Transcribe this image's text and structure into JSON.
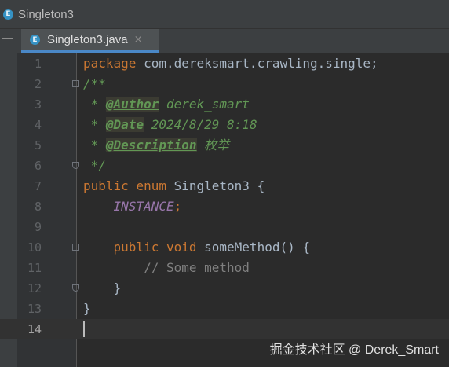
{
  "window": {
    "title": "Singleton3",
    "icon": "enum-class-icon",
    "icon_letter": "E"
  },
  "tab": {
    "label": "Singleton3.java",
    "close": "×",
    "icon_letter": "E",
    "accent": "#4a88c7"
  },
  "editor": {
    "line_numbers": [
      "1",
      "2",
      "3",
      "4",
      "5",
      "6",
      "7",
      "8",
      "9",
      "10",
      "11",
      "12",
      "13",
      "14"
    ],
    "current_line": 14,
    "lines": [
      {
        "kw1": "package",
        "text": " com.dereksmart.crawling.single;"
      },
      {
        "text": "/**"
      },
      {
        "star": " * ",
        "tag": "@Author",
        "rest": " derek_smart"
      },
      {
        "star": " * ",
        "tag": "@Date",
        "rest": " 2024/8/29 8:18"
      },
      {
        "star": " * ",
        "tag": "@Description",
        "rest": " 枚举"
      },
      {
        "text": " */"
      },
      {
        "kw1": "public",
        "kw2": "enum",
        "text": " Singleton3 {"
      },
      {
        "indent": "    ",
        "constant": "INSTANCE",
        "text": ";"
      },
      {
        "text": ""
      },
      {
        "indent": "    ",
        "kw1": "public",
        "kw2": "void",
        "text": " someMethod() {"
      },
      {
        "indent": "        ",
        "comment": "// Some method"
      },
      {
        "text": "    }"
      },
      {
        "text": "}"
      },
      {
        "text": ""
      }
    ]
  },
  "watermark": "掘金技术社区 @ Derek_Smart"
}
